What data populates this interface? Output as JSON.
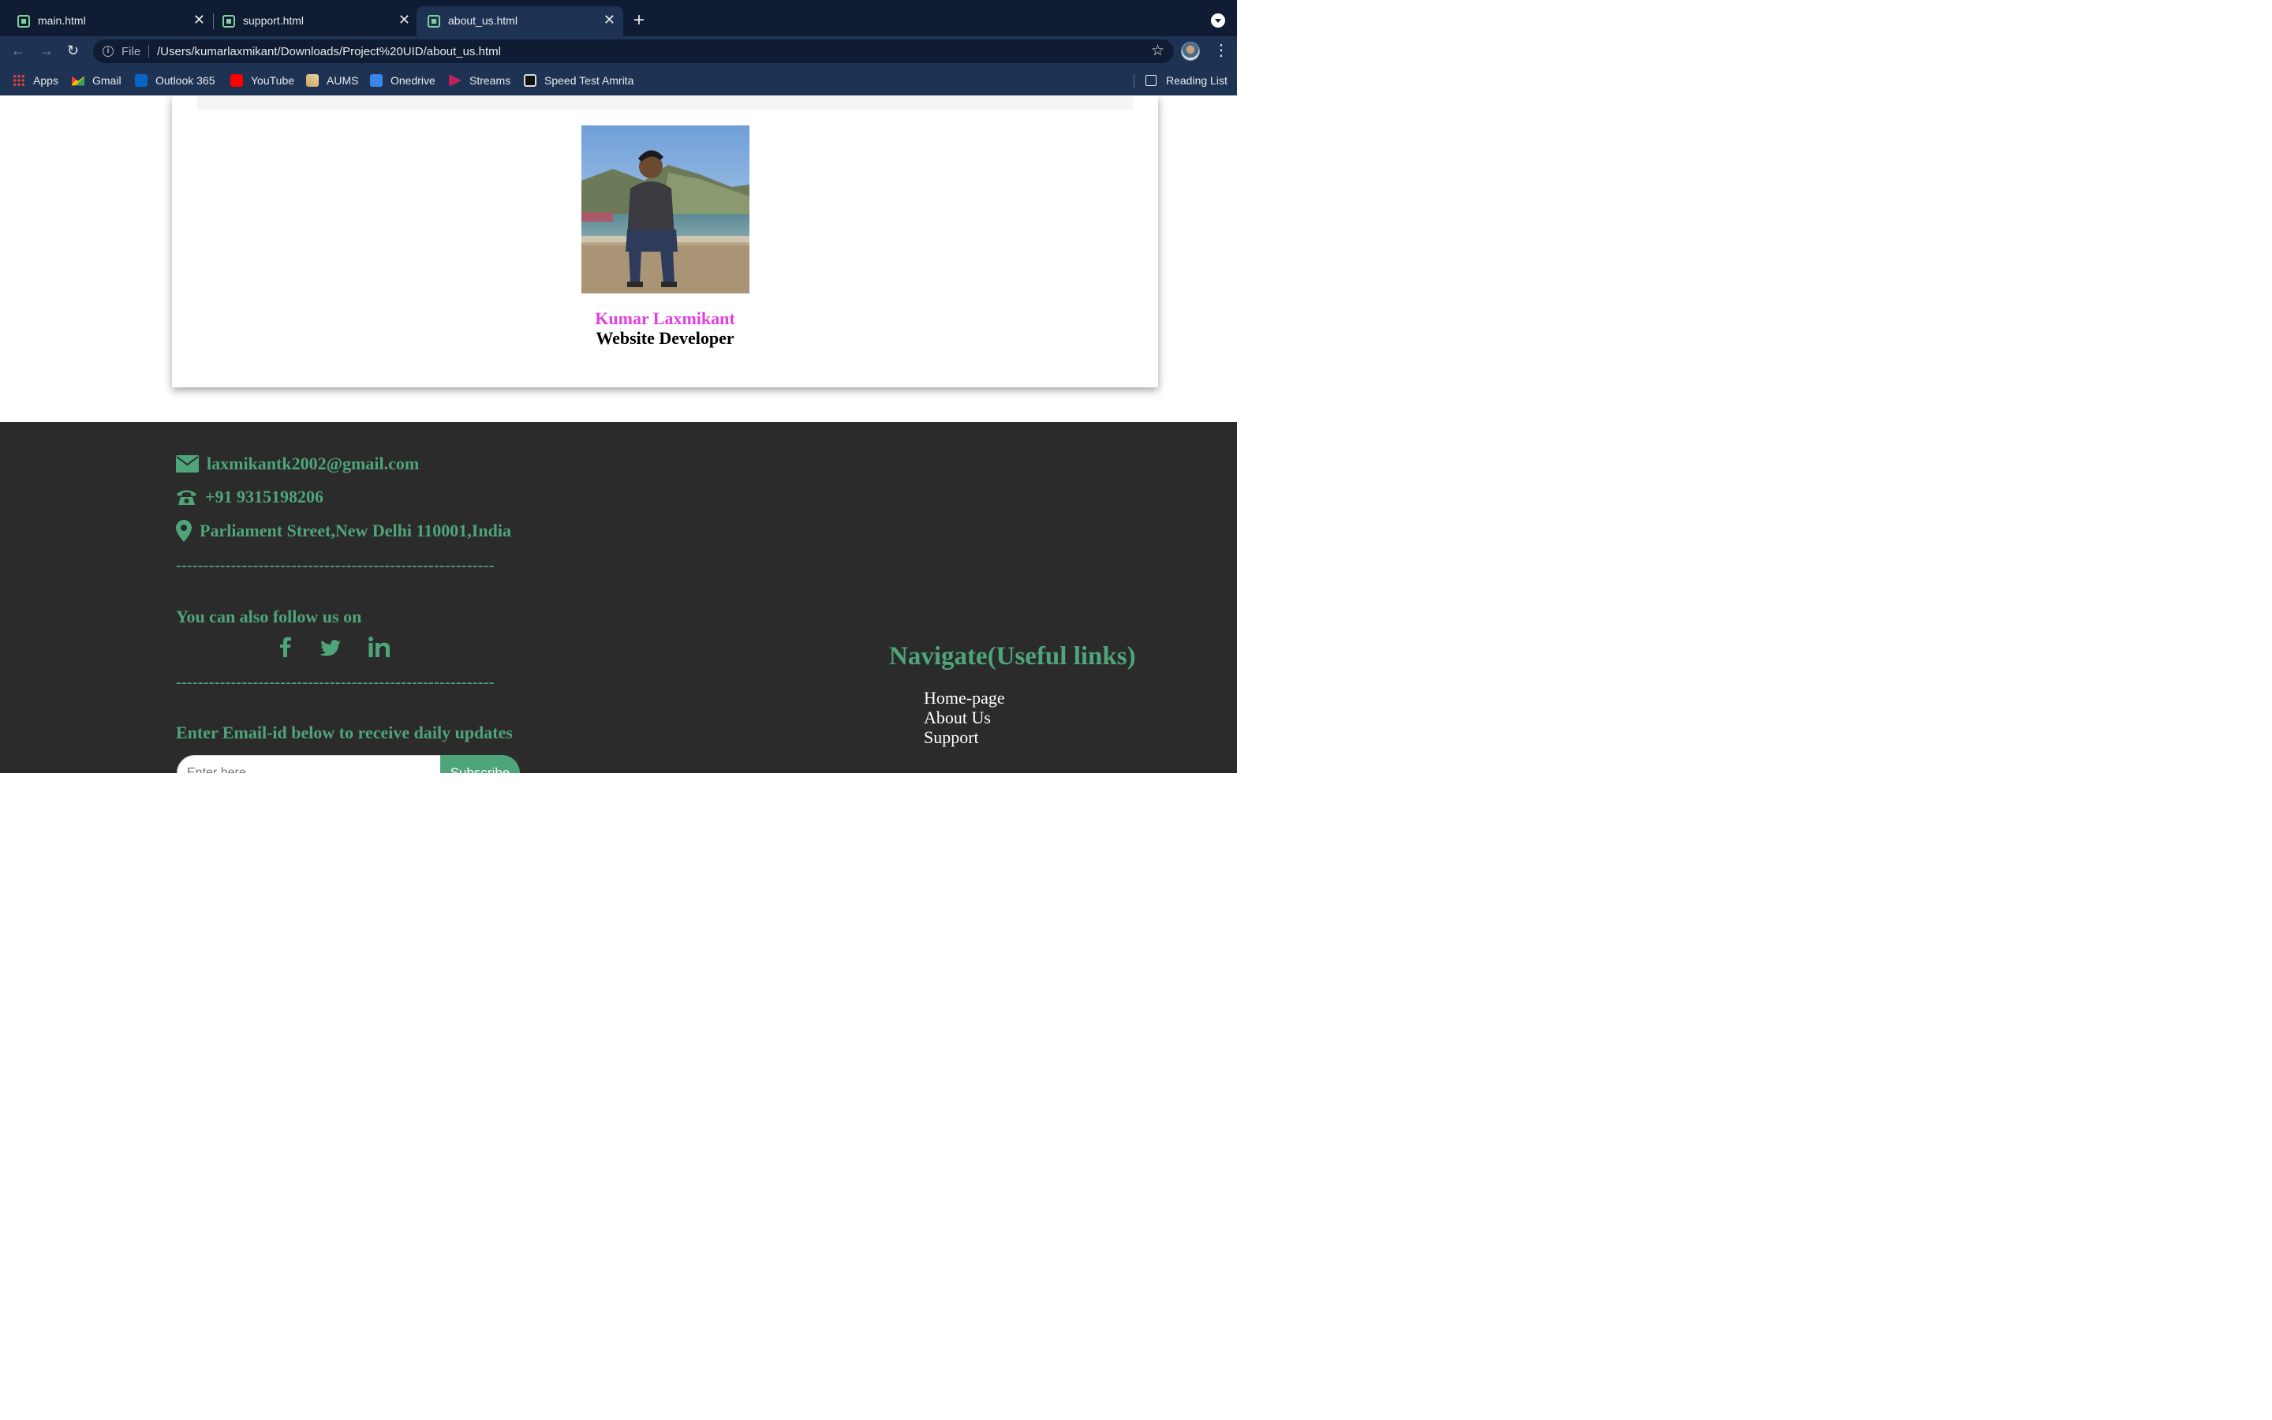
{
  "browser": {
    "tabs": [
      {
        "title": "main.html",
        "active": false
      },
      {
        "title": "support.html",
        "active": false
      },
      {
        "title": "about_us.html",
        "active": true
      }
    ],
    "address": {
      "scheme_label": "File",
      "url": "/Users/kumarlaxmikant/Downloads/Project%20UID/about_us.html"
    },
    "bookmarks": [
      {
        "label": "Apps",
        "icon": "apps-grid-icon"
      },
      {
        "label": "Gmail",
        "icon": "gmail-icon"
      },
      {
        "label": "Outlook 365",
        "icon": "outlook-icon"
      },
      {
        "label": "YouTube",
        "icon": "youtube-icon"
      },
      {
        "label": "AUMS",
        "icon": "aums-icon"
      },
      {
        "label": "Onedrive",
        "icon": "onedrive-icon"
      },
      {
        "label": "Streams",
        "icon": "streams-icon"
      },
      {
        "label": "Speed Test Amrita",
        "icon": "speed-test-icon"
      }
    ],
    "reading_list": "Reading List"
  },
  "team_member": {
    "name": "Kumar Laxmikant",
    "role": "Website Developer",
    "name_color": "#e33fe0"
  },
  "footer": {
    "email": "laxmikantk2002@gmail.com",
    "phone": "+91 9315198206",
    "address": "Parliament Street,New Delhi 110001,India",
    "divider": "----------------------------------------------------------",
    "follow_label": "You can also follow us on",
    "social": [
      "facebook-icon",
      "twitter-icon",
      "linkedin-icon"
    ],
    "subscribe_label": "Enter Email-id below to receive daily updates",
    "input_placeholder": "Enter here",
    "subscribe_button": "Subscribe",
    "nav_heading": "Navigate(Useful links)",
    "nav_links": [
      "Home-page",
      "About Us",
      "Support"
    ],
    "accent_color": "#4fa57a",
    "background": "#2b2b2b"
  }
}
